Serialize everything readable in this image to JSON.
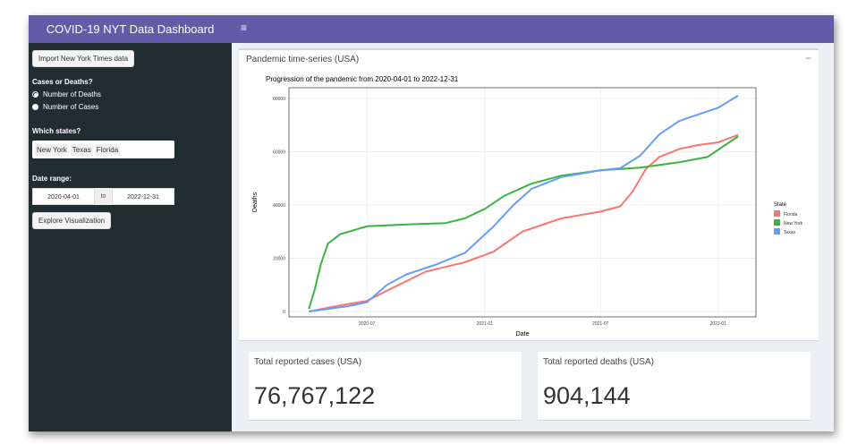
{
  "header": {
    "app_title": "COVID-19 NYT Data Dashboard",
    "menu_icon": "≡"
  },
  "sidebar": {
    "import_button": "Import New York Times data",
    "cases_or_deaths_label": "Cases or Deaths?",
    "options": [
      "Number of Deaths",
      "Number of Cases"
    ],
    "selected_option": "Number of Deaths",
    "states_label": "Which states?",
    "states": [
      "New York",
      "Texas",
      "Florida"
    ],
    "date_range_label": "Date range:",
    "date_start": "2020-04-01",
    "date_sep": "to",
    "date_end": "2022-12-31",
    "explore_button": "Explore Visualization"
  },
  "plot_box": {
    "title": "Pandemic time-series (USA)",
    "collapse_icon": "−"
  },
  "stats": {
    "cases_title": "Total reported cases (USA)",
    "cases_value": "76,767,122",
    "deaths_title": "Total reported deaths (USA)",
    "deaths_value": "904,144"
  },
  "chart_data": {
    "type": "line",
    "title": "Progression of the pandemic from 2020-04-01 to 2022-12-31",
    "xlabel": "Date",
    "ylabel": "Deaths",
    "xlim": [
      "2020-03-01",
      "2022-03-01"
    ],
    "ylim": [
      -2000,
      84000
    ],
    "x_ticks": [
      "2020-07",
      "2021-01",
      "2021-07",
      "2022-01"
    ],
    "y_ticks": [
      0,
      20000,
      40000,
      60000,
      80000
    ],
    "grid": true,
    "legend": {
      "title": "State",
      "position": "right"
    },
    "series": [
      {
        "name": "Florida",
        "color": "#f8766d",
        "x": [
          "2020-04-01",
          "2020-05-15",
          "2020-07-01",
          "2020-08-15",
          "2020-10-01",
          "2020-12-01",
          "2021-01-15",
          "2021-03-01",
          "2021-05-01",
          "2021-07-01",
          "2021-08-01",
          "2021-08-20",
          "2021-09-10",
          "2021-10-01",
          "2021-11-01",
          "2021-12-01",
          "2022-01-01",
          "2022-02-01"
        ],
        "y": [
          0,
          2100,
          4000,
          9500,
          15000,
          18500,
          22500,
          30000,
          35000,
          37500,
          39500,
          45000,
          53500,
          58000,
          61000,
          62500,
          63500,
          66300
        ]
      },
      {
        "name": "New York",
        "color": "#39b53f",
        "x": [
          "2020-04-01",
          "2020-04-10",
          "2020-04-20",
          "2020-05-01",
          "2020-05-20",
          "2020-07-01",
          "2020-09-01",
          "2020-11-01",
          "2020-12-01",
          "2021-01-01",
          "2021-02-01",
          "2021-03-15",
          "2021-05-01",
          "2021-07-01",
          "2021-09-01",
          "2021-11-01",
          "2021-12-15",
          "2022-01-15",
          "2022-02-01"
        ],
        "y": [
          1000,
          8000,
          18000,
          25500,
          29000,
          32000,
          32700,
          33200,
          35000,
          38500,
          43500,
          48000,
          51000,
          53000,
          54000,
          56000,
          58000,
          63000,
          65700
        ]
      },
      {
        "name": "Texas",
        "color": "#619cff",
        "x": [
          "2020-04-01",
          "2020-06-01",
          "2020-07-01",
          "2020-08-01",
          "2020-09-01",
          "2020-10-15",
          "2020-12-01",
          "2021-01-15",
          "2021-02-15",
          "2021-03-15",
          "2021-05-01",
          "2021-07-01",
          "2021-08-01",
          "2021-09-01",
          "2021-10-01",
          "2021-11-01",
          "2021-12-01",
          "2022-01-01",
          "2022-02-01"
        ],
        "y": [
          0,
          2000,
          3500,
          10000,
          14000,
          17500,
          22000,
          32000,
          40000,
          46000,
          50500,
          53000,
          53800,
          58500,
          66500,
          71500,
          74000,
          76500,
          81000
        ]
      }
    ]
  }
}
